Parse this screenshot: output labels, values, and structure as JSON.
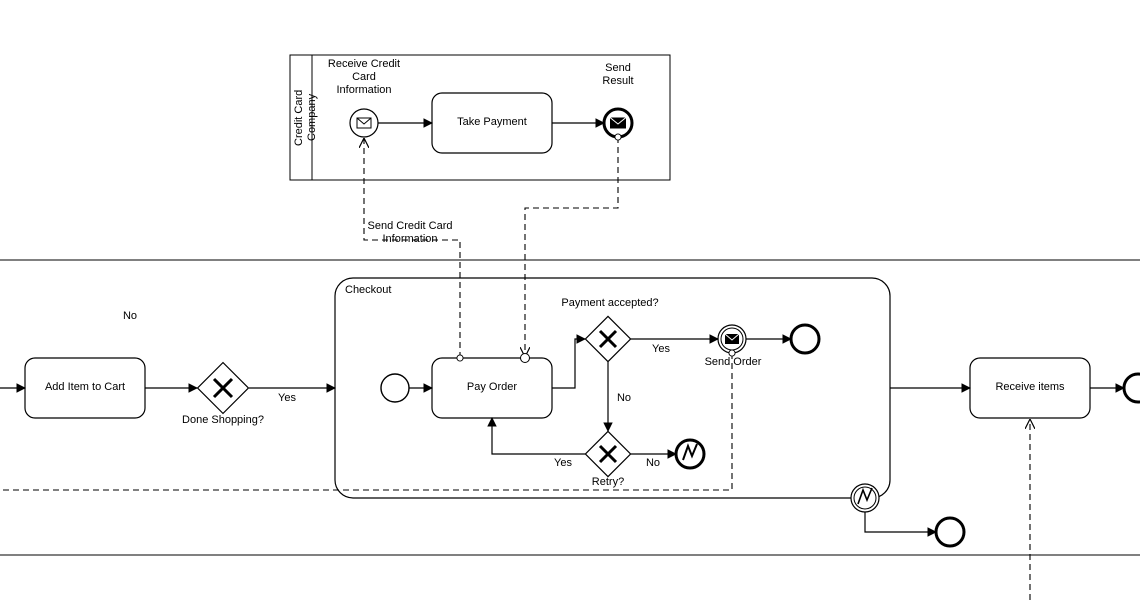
{
  "pool": {
    "ccCompanyLabel": "Credit Card Company",
    "checkoutLabel": "Checkout"
  },
  "ccCompany": {
    "receiveCCLabel": "Receive Credit\nCard\nInformation",
    "takePaymentLabel": "Take Payment",
    "sendResultLabel": "Send\nResult"
  },
  "messages": {
    "sendCCInfoLabel": "Send Credit Card\nInformation"
  },
  "main": {
    "noLabel": "No",
    "addItemLabel": "Add Item to Cart",
    "doneShoppingLabel": "Done Shopping?",
    "yesLabel": "Yes"
  },
  "checkout": {
    "payOrderLabel": "Pay Order",
    "paymentAcceptedLabel": "Payment accepted?",
    "yes1": "Yes",
    "no1": "No",
    "retryLabel": "Retry?",
    "yes2": "Yes",
    "no2": "No",
    "sendOrderLabel": "Send Order"
  },
  "final": {
    "receiveItemsLabel": "Receive items"
  }
}
